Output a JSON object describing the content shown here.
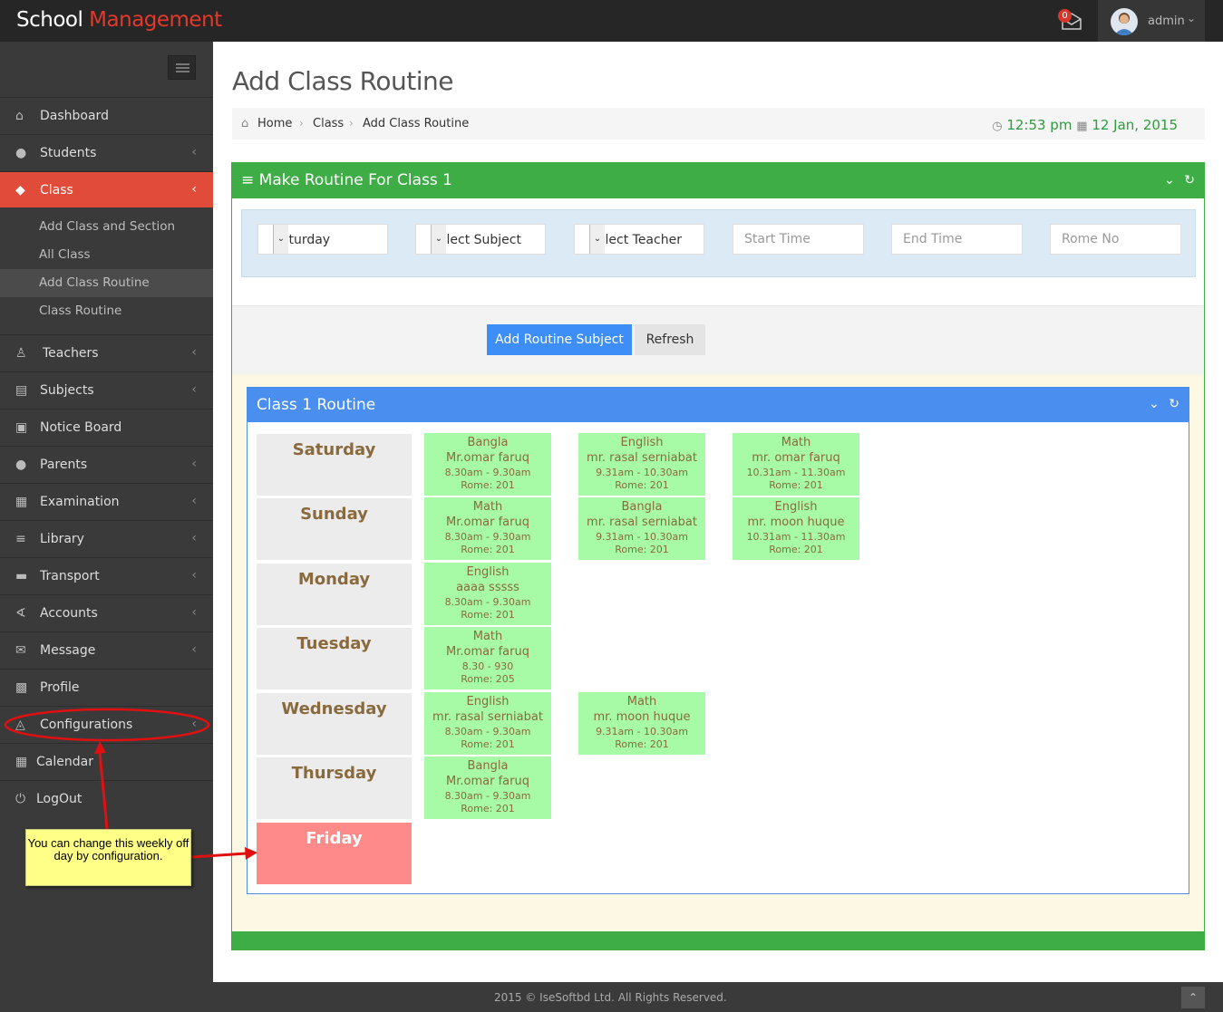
{
  "app": {
    "logo_part1": "School ",
    "logo_part2": "Management",
    "mail_count": "0",
    "user_name": "admin"
  },
  "sidebar": {
    "items": [
      {
        "label": "Dashboard",
        "icon": "home-icon"
      },
      {
        "label": "Students",
        "icon": "users-icon"
      },
      {
        "label": "Class",
        "icon": "cubes-icon"
      },
      {
        "label": "Teachers",
        "icon": "user-icon"
      },
      {
        "label": "Subjects",
        "icon": "book-icon"
      },
      {
        "label": "Notice Board",
        "icon": "clipboard-icon"
      },
      {
        "label": "Parents",
        "icon": "person-icon"
      },
      {
        "label": "Examination",
        "icon": "table-icon"
      },
      {
        "label": "Library",
        "icon": "list-icon"
      },
      {
        "label": "Transport",
        "icon": "truck-icon"
      },
      {
        "label": "Accounts",
        "icon": "share-icon"
      },
      {
        "label": "Message",
        "icon": "envelope-icon"
      },
      {
        "label": "Profile",
        "icon": "qrcode-icon"
      },
      {
        "label": "Configurations",
        "icon": "graduation-cap-icon"
      },
      {
        "label": "Calendar",
        "icon": "calendar-icon"
      },
      {
        "label": "LogOut",
        "icon": "power-icon"
      }
    ],
    "class_sub": [
      "Add Class and Section",
      "All Class",
      "Add Class Routine",
      "Class Routine"
    ]
  },
  "page": {
    "title": "Add Class Routine",
    "breadcrumb": [
      "Home",
      "Class",
      "Add Class Routine"
    ],
    "time": "12:53 pm",
    "date": "12 Jan, 2015"
  },
  "form": {
    "panel_title": "Make Routine For Class 1",
    "day_select": "Saturday",
    "subject_select": "Select Subject",
    "teacher_select": "Select Teacher",
    "start_placeholder": "Start Time",
    "end_placeholder": "End Time",
    "room_placeholder": "Rome No",
    "add_button": "Add Routine Subject",
    "refresh_button": "Refresh"
  },
  "routine": {
    "title": "Class 1 Routine",
    "days": [
      {
        "name": "Saturday",
        "off": false,
        "periods": [
          {
            "subject": "Bangla",
            "teacher": "Mr.omar faruq",
            "time": "8.30am - 9.30am",
            "room": "Rome: 201"
          },
          {
            "subject": "English",
            "teacher": "mr. rasal serniabat",
            "time": "9.31am - 10.30am",
            "room": "Rome: 201"
          },
          {
            "subject": "Math",
            "teacher": "mr. omar faruq",
            "time": "10.31am - 11.30am",
            "room": "Rome: 201"
          }
        ]
      },
      {
        "name": "Sunday",
        "off": false,
        "periods": [
          {
            "subject": "Math",
            "teacher": "Mr.omar faruq",
            "time": "8.30am - 9.30am",
            "room": "Rome: 201"
          },
          {
            "subject": "Bangla",
            "teacher": "mr. rasal serniabat",
            "time": "9.31am - 10.30am",
            "room": "Rome: 201"
          },
          {
            "subject": "English",
            "teacher": "mr. moon huque",
            "time": "10.31am - 11.30am",
            "room": "Rome: 201"
          }
        ]
      },
      {
        "name": "Monday",
        "off": false,
        "periods": [
          {
            "subject": "English",
            "teacher": "aaaa sssss",
            "time": "8.30am - 9.30am",
            "room": "Rome: 201"
          }
        ]
      },
      {
        "name": "Tuesday",
        "off": false,
        "periods": [
          {
            "subject": "Math",
            "teacher": "Mr.omar faruq",
            "time": "8.30 - 930",
            "room": "Rome: 205"
          }
        ]
      },
      {
        "name": "Wednesday",
        "off": false,
        "periods": [
          {
            "subject": "English",
            "teacher": "mr. rasal serniabat",
            "time": "8.30am - 9.30am",
            "room": "Rome: 201"
          },
          {
            "subject": "Math",
            "teacher": "mr. moon huque",
            "time": "9.31am - 10.30am",
            "room": "Rome: 201"
          }
        ]
      },
      {
        "name": "Thursday",
        "off": false,
        "periods": [
          {
            "subject": "Bangla",
            "teacher": "Mr.omar faruq",
            "time": "8.30am - 9.30am",
            "room": "Rome: 201"
          }
        ]
      },
      {
        "name": "Friday",
        "off": true,
        "periods": []
      }
    ]
  },
  "annotation": {
    "note": "You can change this weekly off day by configuration."
  },
  "footer": {
    "copyright": "2015 © IseSoftbd Ltd. All Rights Reserved."
  },
  "colors": {
    "accent_red": "#e04b3a",
    "panel_green": "#3fad46",
    "routine_blue": "#4a8ff0",
    "cell_green": "#a7fba6",
    "offday_red": "#ff8a8a"
  }
}
